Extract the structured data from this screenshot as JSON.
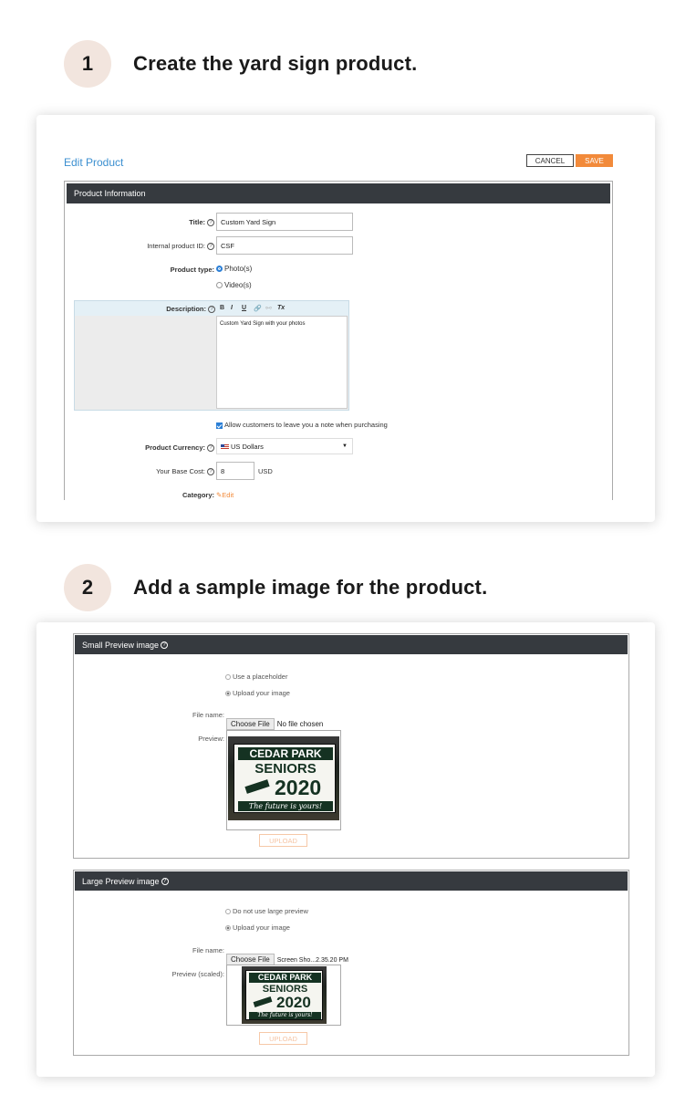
{
  "steps": [
    {
      "number": "1",
      "text": "Create the yard sign product."
    },
    {
      "number": "2",
      "text": "Add a sample image for the product."
    }
  ],
  "edit_product": {
    "title": "Edit Product",
    "cancel_label": "CANCEL",
    "save_label": "SAVE",
    "panel_title": "Product Information",
    "fields": {
      "title_label": "Title:",
      "title_value": "Custom Yard Sign",
      "internal_id_label": "Internal product ID:",
      "internal_id_value": "CSF",
      "product_type_label": "Product type:",
      "product_type_options": [
        "Photo(s)",
        "Video(s)"
      ],
      "product_type_selected": "Photo(s)",
      "description_label": "Description:",
      "description_value": "Custom Yard Sign with your photos",
      "toolbar": [
        "B",
        "I",
        "U",
        "Tx"
      ],
      "allow_note_label": "Allow customers to leave you a note when purchasing",
      "currency_label": "Product Currency:",
      "currency_value": "US Dollars",
      "base_cost_label": "Your Base Cost:",
      "base_cost_value": "8",
      "base_cost_unit": "USD",
      "category_label": "Category:",
      "category_edit": "Edit"
    }
  },
  "small_preview": {
    "panel_title": "Small Preview image",
    "options": [
      "Use a placeholder",
      "Upload your image"
    ],
    "selected": "Upload your image",
    "file_name_label": "File name:",
    "choose_file_label": "Choose File",
    "file_status": "No file chosen",
    "preview_label": "Preview:",
    "upload_label": "UPLOAD"
  },
  "large_preview": {
    "panel_title": "Large Preview image",
    "options": [
      "Do not use large preview",
      "Upload your image"
    ],
    "selected": "Upload your image",
    "file_name_label": "File name:",
    "choose_file_label": "Choose File",
    "file_status": "Screen Sho...2.35.20 PM",
    "preview_label": "Preview (scaled):",
    "upload_label": "UPLOAD"
  },
  "sign_image": {
    "line1": "CEDAR PARK",
    "line2": "SENIORS",
    "year": "2020",
    "tagline": "The future is yours!"
  },
  "colors": {
    "accent_blue": "#3b8fd0",
    "save_orange": "#f28a3a",
    "panel_header": "#363a3f",
    "step_circle": "#f2e5de",
    "sign_green": "#153222"
  }
}
